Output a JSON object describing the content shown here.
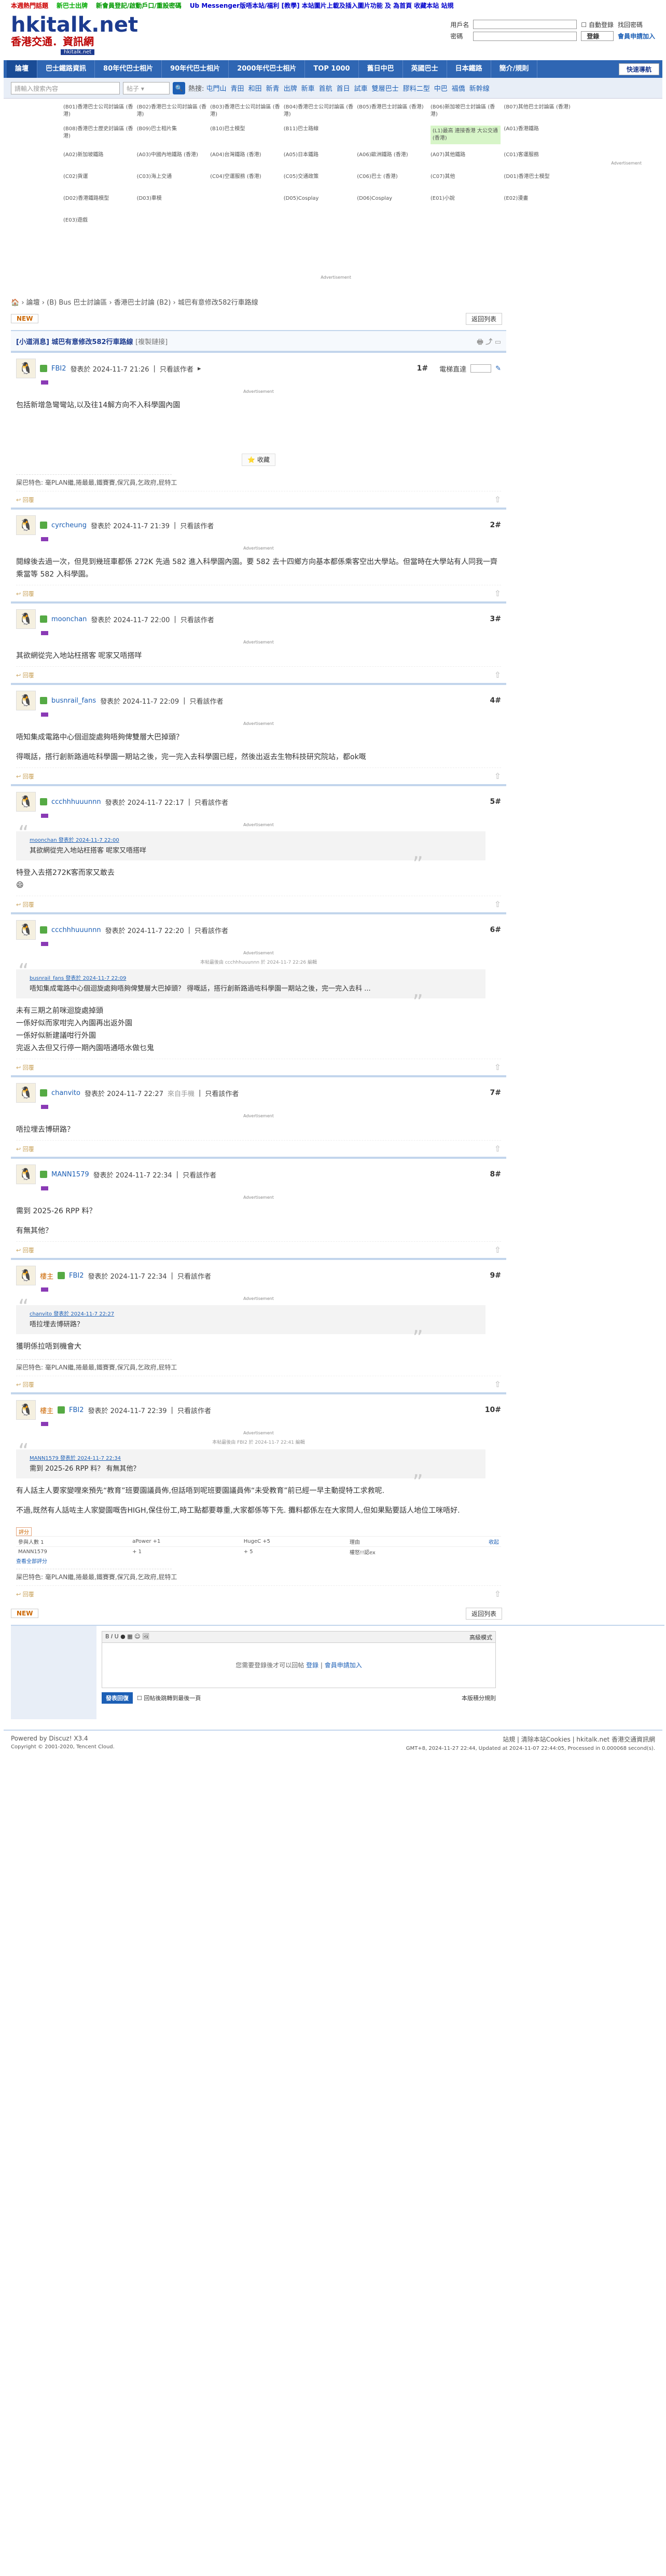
{
  "announce": [
    "本週熱門話題",
    "新巴士出牌",
    "新會員登記/啟動戶口/重設密碼",
    "Ub Messenger版唔本站/福利 [教學] 本站圖片上載及插入圖片功能 及 為首頁 收藏本站 站規"
  ],
  "logo": {
    "line1": "hkitalk.net",
    "line2": "香港交通．資訊網",
    "line3": "hkitalk.net"
  },
  "login": {
    "user_label": "用戶名",
    "pass_label": "密碼",
    "auto": "自動登錄",
    "forgot": "找回密碼",
    "login_btn": "登錄",
    "register": "會員申請加入"
  },
  "nav": [
    "論壇",
    "巴士鐵路資訊",
    "80年代巴士相片",
    "90年代巴士相片",
    "2000年代巴士相片",
    "TOP 1000",
    "舊日中巴",
    "英國巴士",
    "日本鐵路",
    "簡介/規則"
  ],
  "nav_quick": "快速導航",
  "search": {
    "placeholder": "請輸入搜索內容",
    "select": "帖子",
    "hot_label": "熱搜:",
    "hot": [
      "屯門山",
      "青田",
      "和田",
      "新青",
      "出牌",
      "新車",
      "首航",
      "首日",
      "試車",
      "雙層巴士",
      "膠料二型",
      "中巴",
      "福僑",
      "新幹線"
    ]
  },
  "forums": [
    "(B01)香港巴士公司討論區 (香港)",
    "(B02)香港巴士公司討論區 (香港)",
    "(B03)香港巴士公司討論區 (香港)",
    "(B04)香港巴士公司討論區 (香港)",
    "(B05)香港巴士討論區 (香港)",
    "(B06)新加坡巴士討論區 (香港)",
    "(B07)其他巴士討論區 (香港)",
    "(B08)香港巴士歷史討論區 (香港)",
    "(B09)巴士相片集",
    "(B10)巴士模型",
    "(B11)巴士路線",
    "",
    "(A01)香港鐵路",
    "(A02)新加坡鐵路",
    "(A03)中國內地鐵路 (香港)",
    "(A04)台灣鐵路 (香港)",
    "(A05)日本鐵路",
    "(A06)歐洲鐵路 (香港)",
    "(A07)其他鐵路",
    "(C01)客運服務",
    "(C02)貨運",
    "(C03)海上交通",
    "(C04)空運服務 (香港)",
    "(C05)交通政策",
    "(C06)巴士 (香港)",
    "(C07)其他",
    "(D01)香港巴士模型",
    "(D02)香港鐵路模型",
    "(D03)車模",
    "",
    "(D05)Cosplay",
    "(D06)Cosplay",
    "(E01)小說",
    "(E02)漫畫",
    "(E03)遊戲",
    "",
    "",
    "",
    ""
  ],
  "forum_highlight": "(L1)最高 連接香港 大公交通 (香港)",
  "crumb": [
    "論壇",
    "(B) Bus 巴士討論區",
    "香港巴士討論 (B2)",
    "城巴有意修改582行車路線"
  ],
  "buttons": {
    "new": "NEW",
    "back": "返回列表"
  },
  "thread": {
    "title": "[小道消息] 城巴有意修改582行車路線",
    "sub": "[複製鏈接]"
  },
  "posts": [
    {
      "num": "1",
      "user": "FBI2",
      "time": "發表於 2024-11-7 21:26",
      "only": "只看該作者",
      "msg": [
        "包括新增急彎彎站,以及往14解方向不入科學園內園"
      ],
      "sig": "屎巴特色: 毫PLAN繼,捲最最,鐵賽賽,保冗員,乞政府,屁特工"
    },
    {
      "num": "2",
      "user": "cyrcheung",
      "time": "發表於 2024-11-7 21:39",
      "only": "只看該作者",
      "msg": [
        "閱線後去過一次，但見到幾班車都係 272K 先過 582 進入科學園內園。要 582 去十四鄉方向基本都係乘客空出大學站。但當時在大學站有人同我一齊乘當等 582 入科學園。"
      ],
      "sig": ""
    },
    {
      "num": "3",
      "user": "moonchan",
      "time": "發表於 2024-11-7 22:00",
      "only": "只看該作者",
      "msg": [
        "其欲網從完入地站枉搭客 呢家又唔搭咩"
      ],
      "sig": ""
    },
    {
      "num": "4",
      "user": "busnrail_fans",
      "time": "發表於 2024-11-7 22:09",
      "only": "只看該作者",
      "msg": [
        "唔知集成電路中心個迴旋處夠唔夠俾雙層大巴掉頭？",
        "得嘅話，搭行創新路過咗科學園一期站之後，完一完入去科學園已經，然後出返去生物科技研究院站，都ok嘅"
      ],
      "sig": ""
    },
    {
      "num": "5",
      "user": "ccchhhuuunnn",
      "time": "發表於 2024-11-7 22:17",
      "only": "只看該作者",
      "quote": {
        "meta": "moonchan 發表於 2024-11-7 22:00",
        "text": "其欲網從完入地站枉搭客 呢家又唔搭咩"
      },
      "msg": [
        "特登入去搭272K客而家又敢去"
      ],
      "sig": ""
    },
    {
      "num": "6",
      "user": "ccchhhuuunnn",
      "time": "發表於 2024-11-7 22:20",
      "only": "只看該作者",
      "edit": "本帖最後由 ccchhhuuunnn 於 2024-11-7 22:26 編輯",
      "quote": {
        "meta": "busnrail_fans 發表於 2024-11-7 22:09",
        "text": "唔知集成電路中心個迴旋處夠唔夠俾雙層大巴掉頭？ 得嘅話，搭行創新路過咗科學園一期站之後，完一完入去科 ..."
      },
      "msg": [
        "未有三期之前咪迴旋處掉頭",
        "一係好似而家咁完入內園再出返外園",
        "一係好似新建議咁行外園",
        "完返入去但又行停一期內園唔通唔水做乜鬼"
      ],
      "sig": ""
    },
    {
      "num": "7",
      "user": "chanvito",
      "time": "發表於 2024-11-7 22:27",
      "only": "只看該作者",
      "extra": "來自手機",
      "msg": [
        "唔拉埋去博研路？"
      ],
      "sig": ""
    },
    {
      "num": "8",
      "user": "MANN1579",
      "time": "發表於 2024-11-7 22:34",
      "only": "只看該作者",
      "msg": [
        "需到 2025-26 RPP 料？",
        "有無其他？"
      ],
      "sig": ""
    },
    {
      "num": "9",
      "user": "FBI2",
      "time": "發表於 2024-11-7 22:34",
      "only": "只看該作者",
      "role": "樓主",
      "quote": {
        "meta": "chanvito 發表於 2024-11-7 22:27",
        "text": "唔拉埋去博研路？"
      },
      "msg": [
        "獲明係拉唔到機會大"
      ],
      "sig": "屎巴特色: 毫PLAN繼,捲最最,鐵賽賽,保冗員,乞政府,屁特工"
    },
    {
      "num": "10",
      "user": "FBI2",
      "time": "發表於 2024-11-7 22:39",
      "only": "只看該作者",
      "role": "樓主",
      "edit": "本帖最後由 FBI2 於 2024-11-7 22:41 編輯",
      "quote": {
        "meta": "MANN1579 發表於 2024-11-7 22:34",
        "text": "需到 2025-26 RPP 料？ 有無其他？"
      },
      "msg": [
        "有人話主人要家變哩來預先“教育”班要園議員佈,但話唔到呢班要園議員佈“未受教育”前已經一早主動提特工求救呢.",
        "不過,既然有人話咗主人家變園嘅告HIGH,保住份工,時工點都要尊重,大家都係等下先. 攤料都係左在大家問人,但如果點要話人地位工咪唔好."
      ],
      "sig": "屎巴特色: 毫PLAN繼,捲最最,鐵賽賽,保冗員,乞政府,屁特工"
    }
  ],
  "rating": {
    "btn": "評分",
    "head": [
      "參與人數 1",
      "aPower +1",
      "HugeC +5",
      "理由"
    ],
    "row": [
      "MANN1579",
      "+ 1",
      "+ 5",
      "權怒!!認ex"
    ],
    "more": "查看全部評分",
    "right": "收起"
  },
  "tools": {
    "collect": "收藏",
    "track": "電梯直達"
  },
  "reply": {
    "mode": "高級模式",
    "hint1": "您需要登錄後才可以回帖",
    "hint_login": "登錄",
    "hint_sep": " | ",
    "hint_reg": "會員申請加入",
    "submit": "發表回復",
    "check": "回帖後跳轉到最後一頁",
    "rule": "本版積分規則"
  },
  "footer": {
    "left1": "Powered by Discuz! X3.4",
    "left2": "Copyright © 2001-2020, Tencent Cloud.",
    "right1": "站規 | 清除本站Cookies | hkitalk.net 香港交通資訊網",
    "right2": "GMT+8, 2024-11-27 22:44, Updated at 2024-11-07 22:44:05, Processed in 0.000068 second(s)."
  },
  "ad_label": "Advertisement"
}
